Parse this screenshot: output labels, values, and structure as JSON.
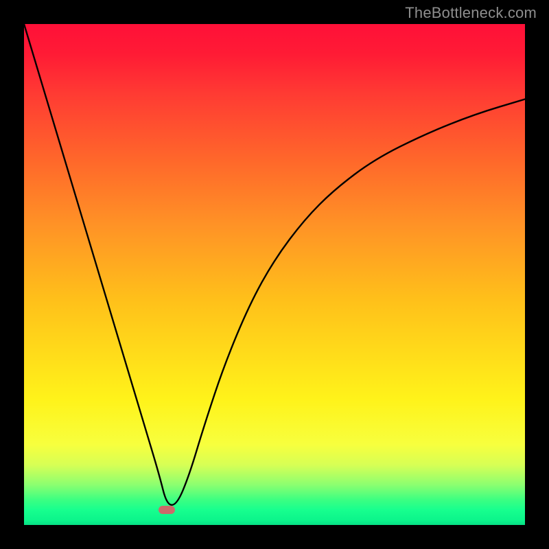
{
  "watermark": "TheBottleneck.com",
  "chart_data": {
    "type": "line",
    "title": "",
    "xlabel": "",
    "ylabel": "",
    "xlim": [
      0,
      100
    ],
    "ylim": [
      0,
      100
    ],
    "grid": false,
    "series": [
      {
        "name": "curve",
        "x": [
          0,
          3,
          6,
          9,
          12,
          15,
          18,
          21,
          24,
          27,
          28.5,
          30.5,
          33,
          36,
          40,
          45,
          50,
          56,
          62,
          70,
          80,
          90,
          100
        ],
        "values": [
          100,
          90,
          80,
          70,
          60,
          50,
          40,
          30,
          20,
          10,
          4,
          4,
          10,
          20,
          32,
          44,
          53,
          61,
          67,
          73,
          78,
          82,
          85
        ]
      }
    ],
    "marker": {
      "x": 28.5,
      "y": 3,
      "color": "#cc6a6a"
    },
    "background_gradient": {
      "top": "#ff1038",
      "mid": "#fff31a",
      "bottom": "#07e085"
    }
  }
}
